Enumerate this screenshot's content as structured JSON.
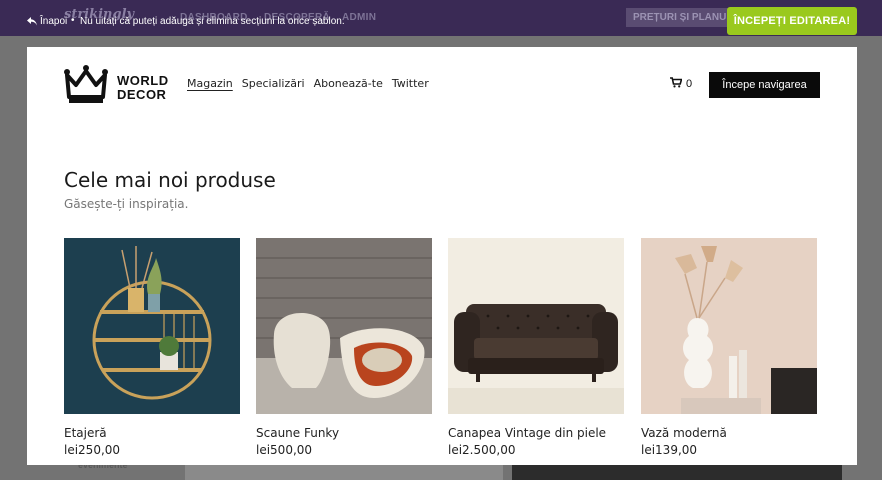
{
  "background": {
    "logo": "strikingly",
    "nav": [
      "DASHBOARD",
      "DESCOPERĂ",
      "ADMIN"
    ],
    "pricing": "PREȚURI ȘI PLANURI",
    "side_text": "evenimente"
  },
  "editor_bar": {
    "back_label": "Înapoi",
    "separator": "•",
    "notice": "Nu uitați că puteți adăuga și elimina secțiuni la orice șablon.",
    "start_button": "ÎNCEPEȚI EDITAREA!"
  },
  "site": {
    "brand_line1": "WORLD",
    "brand_line2": "DECOR",
    "nav": [
      {
        "label": "Magazin"
      },
      {
        "label": "Specializări"
      },
      {
        "label": "Abonează-te"
      },
      {
        "label": "Twitter"
      }
    ],
    "cart_count": "0",
    "cta_button": "Începe navigarea",
    "section_title": "Cele mai noi produse",
    "section_subtitle": "Găsește-ți inspirația.",
    "products": [
      {
        "name": "Etajeră",
        "price": "lei250,00"
      },
      {
        "name": "Scaune Funky",
        "price": "lei500,00"
      },
      {
        "name": "Canapea Vintage din piele",
        "price": "lei2.500,00"
      },
      {
        "name": "Vază modernă",
        "price": "lei139,00"
      }
    ]
  },
  "colors": {
    "accent_green": "#9ac91d",
    "topbar_purple": "#3a2a55",
    "black": "#0a0a0a"
  }
}
